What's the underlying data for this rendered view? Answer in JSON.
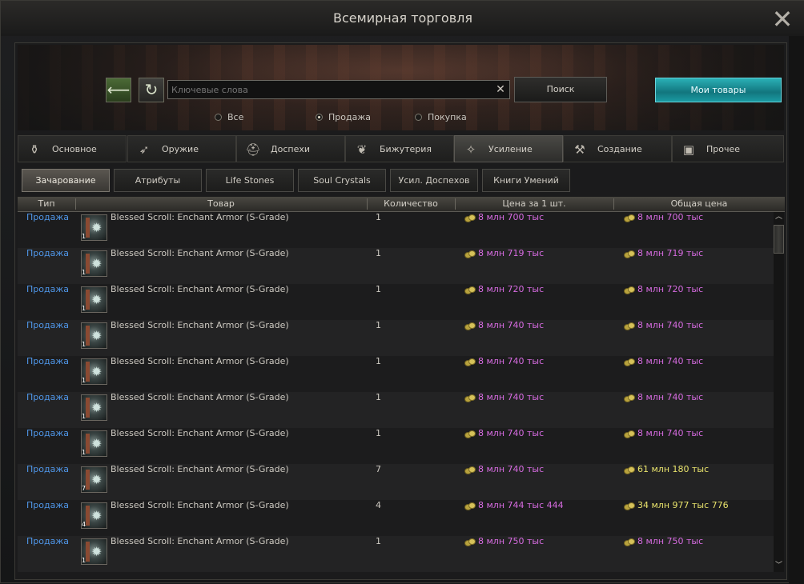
{
  "window": {
    "title": "Всемирная торговля",
    "close_symbol": "✕"
  },
  "search": {
    "back_symbol": "⟵",
    "refresh_symbol": "↻",
    "placeholder": "Ключевые слова",
    "value": "",
    "clear_symbol": "✕",
    "search_label": "Поиск",
    "my_items_label": "Мои товары"
  },
  "filters": [
    {
      "label": "Все",
      "selected": false
    },
    {
      "label": "Продажа",
      "selected": true
    },
    {
      "label": "Покупка",
      "selected": false
    }
  ],
  "categories": [
    {
      "label": "Основное",
      "icon": "coins-icon",
      "glyph": "⚱",
      "active": false
    },
    {
      "label": "Оружие",
      "icon": "bow-icon",
      "glyph": "➶",
      "active": false
    },
    {
      "label": "Доспехи",
      "icon": "helmet-icon",
      "glyph": "⛑",
      "active": false
    },
    {
      "label": "Бижутерия",
      "icon": "necklace-icon",
      "glyph": "❦",
      "active": false
    },
    {
      "label": "Усиление",
      "icon": "enchant-icon",
      "glyph": "✧",
      "active": true
    },
    {
      "label": "Создание",
      "icon": "craft-icon",
      "glyph": "⚒",
      "active": false
    },
    {
      "label": "Прочее",
      "icon": "box-icon",
      "glyph": "▣",
      "active": false
    }
  ],
  "subcategories": [
    {
      "label": "Зачарование",
      "active": true
    },
    {
      "label": "Атрибуты",
      "active": false
    },
    {
      "label": "Life Stones",
      "active": false
    },
    {
      "label": "Soul Crystals",
      "active": false
    },
    {
      "label": "Усил. Доспехов",
      "active": false
    },
    {
      "label": "Книги Умений",
      "active": false
    }
  ],
  "table": {
    "headers": {
      "type": "Тип",
      "item": "Товар",
      "count": "Количество",
      "unit_price": "Цена за 1 шт.",
      "total_price": "Общая цена"
    },
    "rows": [
      {
        "type": "Продажа",
        "item": "Blessed Scroll: Enchant Armor (S-Grade)",
        "badge": "1",
        "count": "1",
        "unit_price": "8 млн 700 тыс",
        "total_price": "8 млн 700 тыс",
        "total_color": "pink"
      },
      {
        "type": "Продажа",
        "item": "Blessed Scroll: Enchant Armor (S-Grade)",
        "badge": "1",
        "count": "1",
        "unit_price": "8 млн 719 тыс",
        "total_price": "8 млн 719 тыс",
        "total_color": "pink"
      },
      {
        "type": "Продажа",
        "item": "Blessed Scroll: Enchant Armor (S-Grade)",
        "badge": "1",
        "count": "1",
        "unit_price": "8 млн 720 тыс",
        "total_price": "8 млн 720 тыс",
        "total_color": "pink"
      },
      {
        "type": "Продажа",
        "item": "Blessed Scroll: Enchant Armor (S-Grade)",
        "badge": "1",
        "count": "1",
        "unit_price": "8 млн 740 тыс",
        "total_price": "8 млн 740 тыс",
        "total_color": "pink"
      },
      {
        "type": "Продажа",
        "item": "Blessed Scroll: Enchant Armor (S-Grade)",
        "badge": "1",
        "count": "1",
        "unit_price": "8 млн 740 тыс",
        "total_price": "8 млн 740 тыс",
        "total_color": "pink"
      },
      {
        "type": "Продажа",
        "item": "Blessed Scroll: Enchant Armor (S-Grade)",
        "badge": "1",
        "count": "1",
        "unit_price": "8 млн 740 тыс",
        "total_price": "8 млн 740 тыс",
        "total_color": "pink"
      },
      {
        "type": "Продажа",
        "item": "Blessed Scroll: Enchant Armor (S-Grade)",
        "badge": "1",
        "count": "1",
        "unit_price": "8 млн 740 тыс",
        "total_price": "8 млн 740 тыс",
        "total_color": "pink"
      },
      {
        "type": "Продажа",
        "item": "Blessed Scroll: Enchant Armor (S-Grade)",
        "badge": "7",
        "count": "7",
        "unit_price": "8 млн 740 тыс",
        "total_price": "61 млн 180 тыс",
        "total_color": "yellow"
      },
      {
        "type": "Продажа",
        "item": "Blessed Scroll: Enchant Armor (S-Grade)",
        "badge": "4",
        "count": "4",
        "unit_price": "8 млн 744 тыс 444",
        "total_price": "34 млн 977 тыс 776",
        "total_color": "yellow"
      },
      {
        "type": "Продажа",
        "item": "Blessed Scroll: Enchant Armor (S-Grade)",
        "badge": "1",
        "count": "1",
        "unit_price": "8 млн 750 тыс",
        "total_price": "8 млн 750 тыс",
        "total_color": "pink"
      }
    ]
  },
  "scroll": {
    "up_symbol": "︿",
    "down_symbol": "﹀"
  },
  "colors": {
    "sell_link": "#4f96e8",
    "price_pink": "#d66be0",
    "price_yellow": "#e9e36c",
    "accent_teal": "#2ab0b6"
  }
}
